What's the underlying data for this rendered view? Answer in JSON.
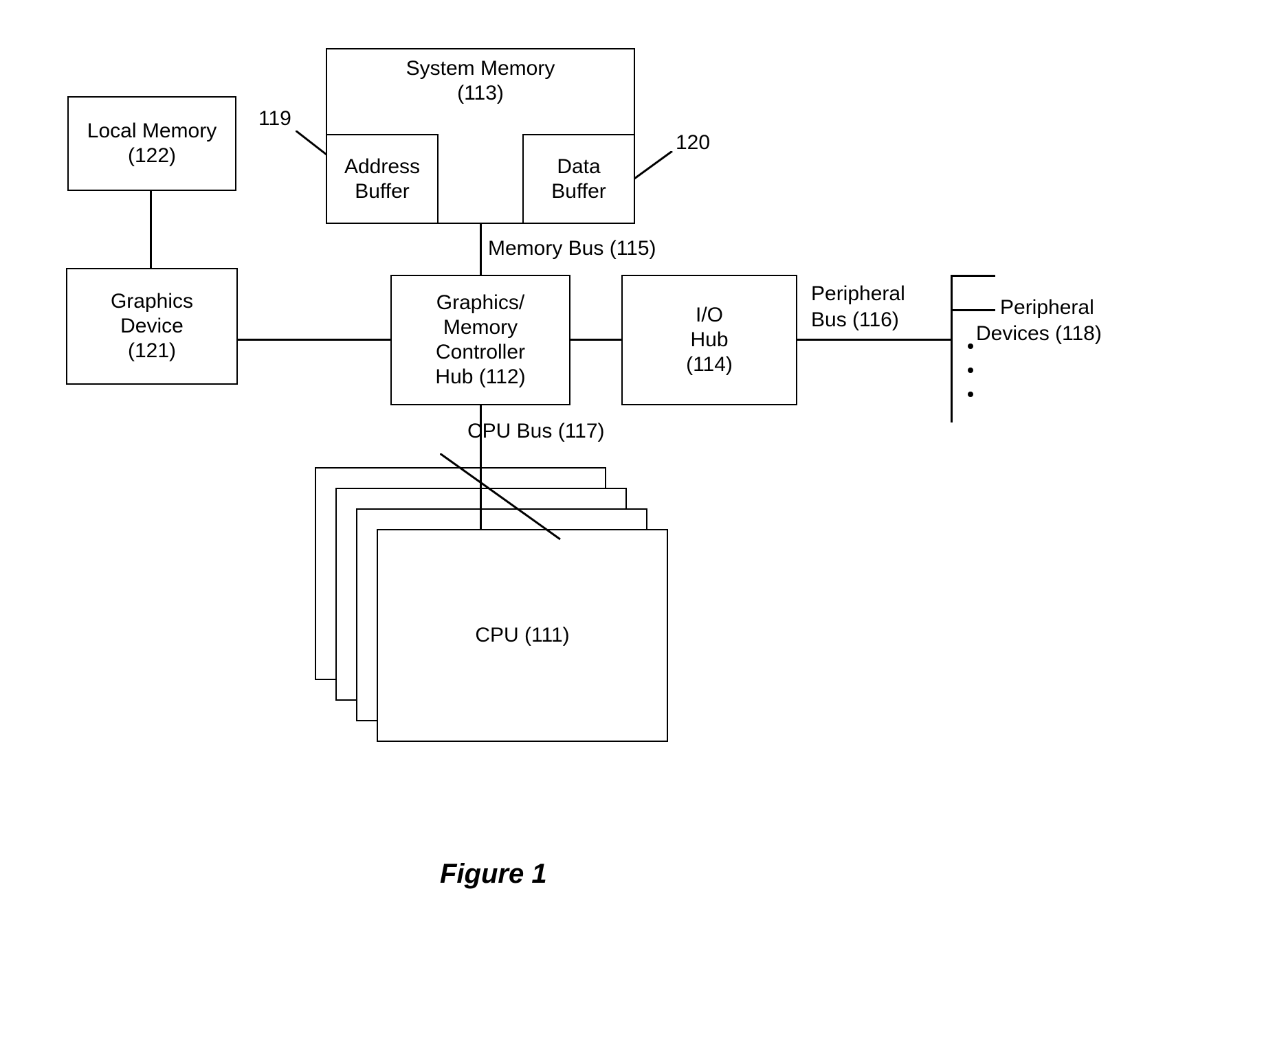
{
  "boxes": {
    "local_memory": {
      "line1": "Local Memory",
      "line2": "(122)"
    },
    "graphics_device": {
      "line1": "Graphics",
      "line2": "Device",
      "line3": "(121)"
    },
    "system_memory": {
      "line1": "System Memory",
      "line2": "(113)"
    },
    "address_buffer": {
      "line1": "Address",
      "line2": "Buffer"
    },
    "data_buffer": {
      "line1": "Data",
      "line2": "Buffer"
    },
    "gmch": {
      "line1": "Graphics/",
      "line2": "Memory",
      "line3": "Controller",
      "line4": "Hub (112)"
    },
    "io_hub": {
      "line1": "I/O",
      "line2": "Hub",
      "line3": "(114)"
    },
    "cpu": "CPU (111)"
  },
  "labels": {
    "memory_bus": "Memory Bus (115)",
    "cpu_bus": "CPU Bus (117)",
    "peripheral_bus_l1": "Peripheral",
    "peripheral_bus_l2": "Bus (116)",
    "peripheral_devices_l1": "Peripheral",
    "peripheral_devices_l2": "Devices (118)",
    "ref_119": "119",
    "ref_120": "120"
  },
  "caption": "Figure 1"
}
